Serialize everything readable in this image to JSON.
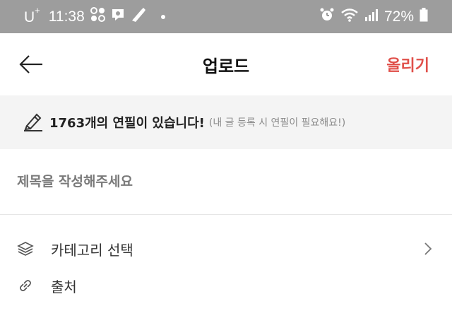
{
  "status_bar": {
    "carrier": "U",
    "carrier_sup": "+",
    "time": "11:38",
    "battery": "72%"
  },
  "app_bar": {
    "title": "업로드",
    "action_label": "올리기",
    "accent_color": "#e0504a"
  },
  "banner": {
    "count_text": "1763개의 연필이 있습니다!",
    "note": "(내 글 등록 시 연필이 필요해요!)"
  },
  "form": {
    "title_placeholder": "제목을 작성해주세요",
    "category_label": "카테고리 선택",
    "source_label": "출처"
  }
}
